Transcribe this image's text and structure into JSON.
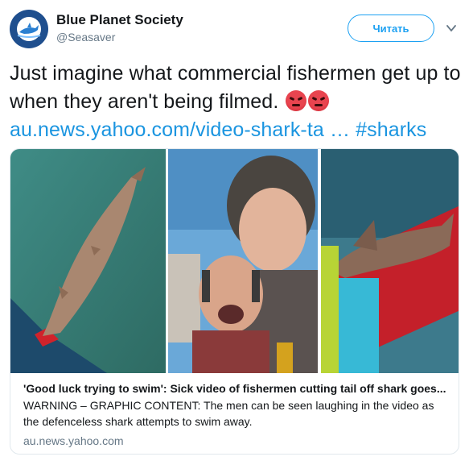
{
  "user": {
    "display_name": "Blue Planet Society",
    "handle": "@Seasaver"
  },
  "follow_button": {
    "label": "Читать"
  },
  "tweet": {
    "text": "Just imagine what commercial fishermen get up to when they aren't being filmed.",
    "link_text": "au.news.yahoo.com/video-shark-ta",
    "ellipsis": "…",
    "hashtag": "#sharks",
    "emoji": [
      "angry-face",
      "angry-face"
    ]
  },
  "card": {
    "title": "'Good luck trying to swim': Sick video of fishermen cutting tail off shark goes...",
    "description": "WARNING – GRAPHIC CONTENT: The men can be seen laughing in the video as the defenceless shark attempts to swim away.",
    "domain": "au.news.yahoo.com"
  },
  "colors": {
    "link": "#1b95e0",
    "follow_border": "#1da1f2",
    "secondary_text": "#657786"
  }
}
